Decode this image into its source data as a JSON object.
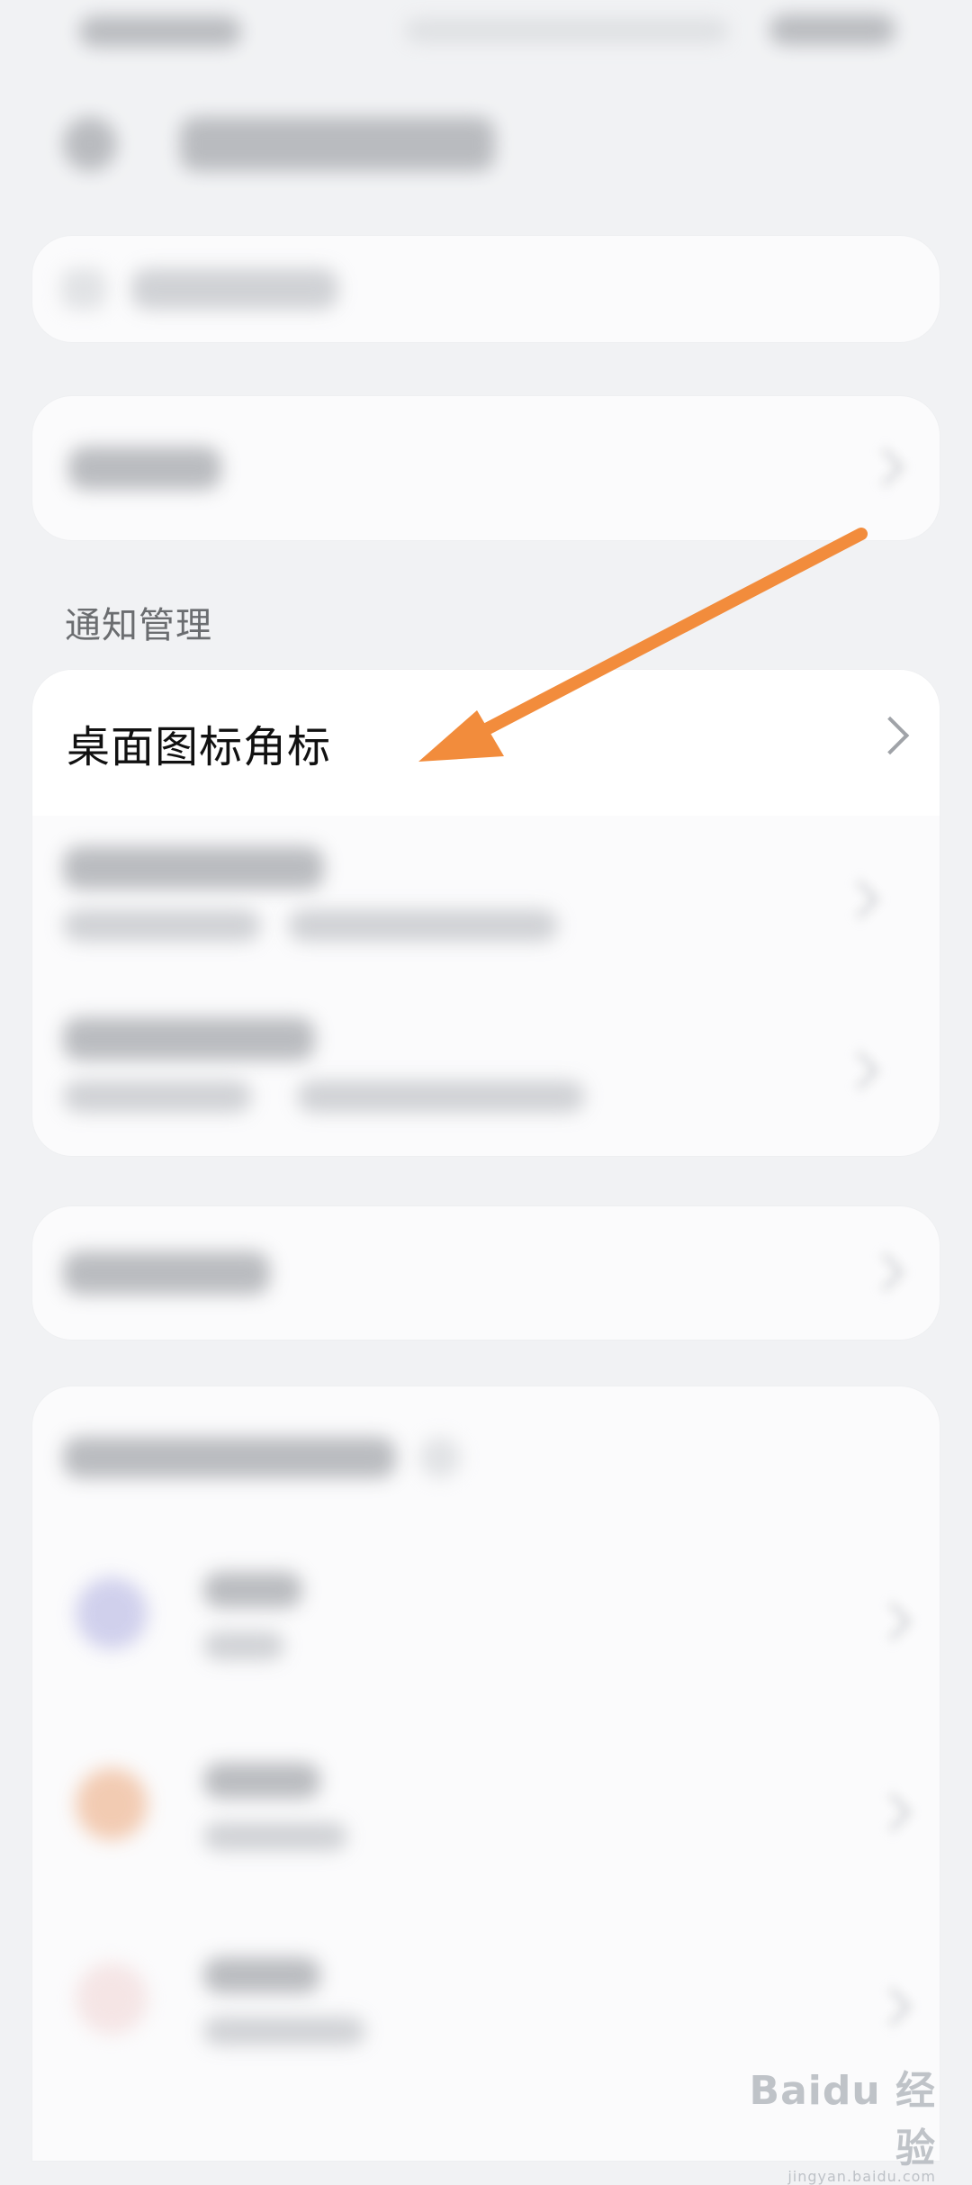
{
  "section": {
    "title": "通知管理"
  },
  "badge_row": {
    "label": "桌面图标角标"
  },
  "annotation": {
    "arrow_color": "#F28C3C"
  },
  "watermark": {
    "main": "Baidu 经验",
    "sub": "jingyan.baidu.com"
  }
}
